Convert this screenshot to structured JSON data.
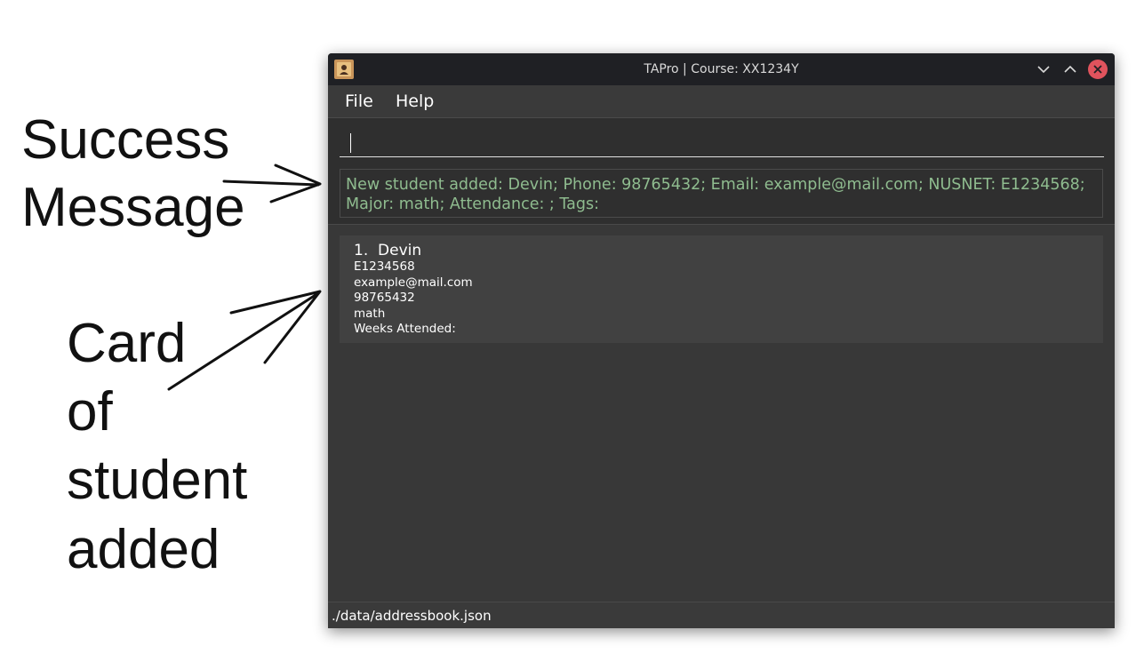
{
  "annotations": {
    "success_line1": "Success",
    "success_line2": "Message",
    "card_line1": "Card",
    "card_line2": "of",
    "card_line3": "student",
    "card_line4": "added"
  },
  "window": {
    "title": "TAPro | Course: XX1234Y",
    "app_icon": "person-icon",
    "controls": [
      "minimize-icon",
      "maximize-icon",
      "close-icon"
    ]
  },
  "menu": {
    "file_label": "File",
    "help_label": "Help"
  },
  "command_box": {
    "value": "",
    "placeholder": ""
  },
  "result": {
    "message": "New student added: Devin; Phone: 98765432; Email: example@mail.com; NUSNET: E1234568; Major: math; Attendance: ; Tags:"
  },
  "students": [
    {
      "index_name": "1.  Devin",
      "nusnet": "E1234568",
      "email": "example@mail.com",
      "phone": "98765432",
      "major": "math",
      "attendance": "Weeks Attended:"
    }
  ],
  "status_bar": {
    "path": "./data/addressbook.json"
  },
  "colors": {
    "titlebar": "#1f2024",
    "background": "#2f2f2f",
    "result_text": "#8fbc8f",
    "card": "#414141",
    "close_button": "#e0535d"
  }
}
